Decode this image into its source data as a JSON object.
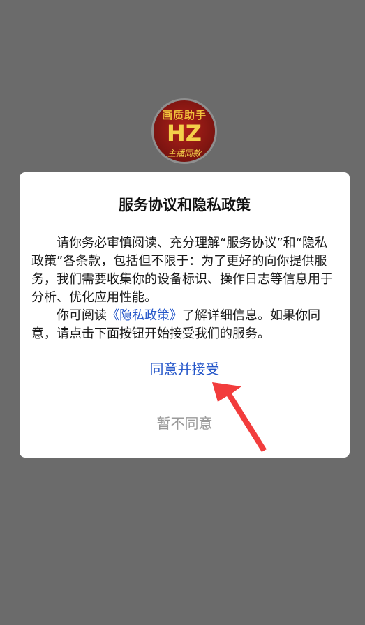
{
  "logo": {
    "top_text": "画质助手",
    "main_text": "HZ",
    "bottom_text": "主播同款"
  },
  "dialog": {
    "title": "服务协议和隐私政策",
    "paragraph1": "请你务必审慎阅读、充分理解“服务协议”和“隐私政策”各条款，包括但不限于：为了更好的向你提供服务，我们需要收集你的设备标识、操作日志等信息用于分析、优化应用性能。",
    "paragraph2_before": "你可阅读",
    "privacy_link": "《隐私政策》",
    "paragraph2_after": "了解详细信息。如果你同意，请点击下面按钮开始接受我们的服务。",
    "agree_label": "同意并接受",
    "disagree_label": "暂不同意"
  },
  "colors": {
    "overlay": "#6b6b6b",
    "link": "#2355c9",
    "disabled_text": "#9a9a9a",
    "arrow": "#f23c3c"
  }
}
